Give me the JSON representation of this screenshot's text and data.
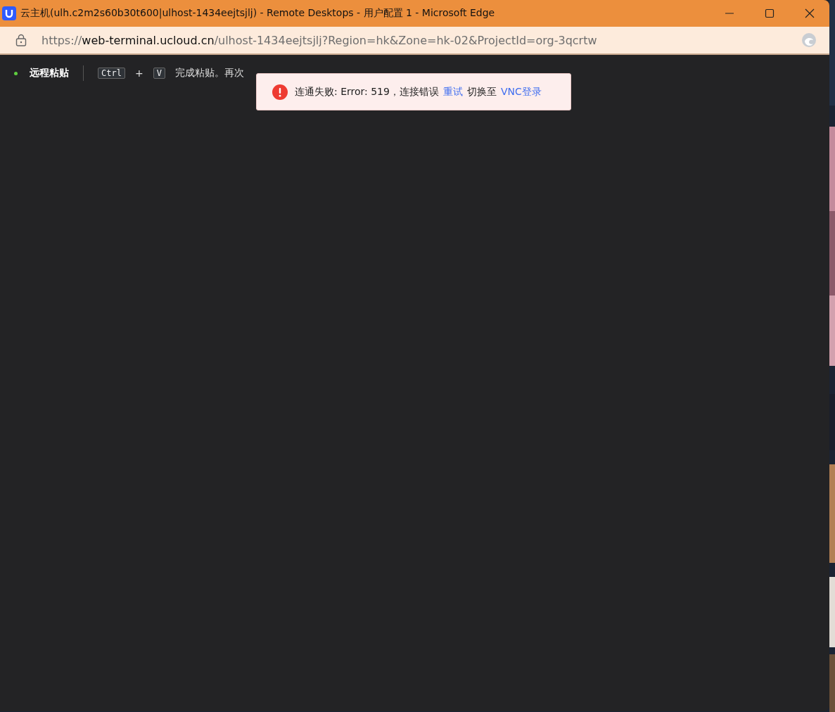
{
  "window": {
    "title": "云主机(ulh.c2m2s60b30t600|ulhost-1434eejtsjlj) - Remote Desktops - 用户配置 1 - Microsoft Edge"
  },
  "address_bar": {
    "scheme": "https://",
    "host": "web-terminal.ucloud.cn",
    "path": "/ulhost-1434eejtsjlj?Region=hk&Zone=hk-02&ProjectId=org-3qcrtw"
  },
  "toolbar": {
    "mode_label": "远程粘贴",
    "active": true,
    "keys": [
      "Ctrl",
      "V"
    ],
    "plus": "+",
    "hint": "完成粘贴。再次"
  },
  "toast": {
    "message": "连通失败: Error: 519，连接错误",
    "retry_link": "重试",
    "switch_text": "切换至",
    "vnc_link": "VNC登录"
  }
}
